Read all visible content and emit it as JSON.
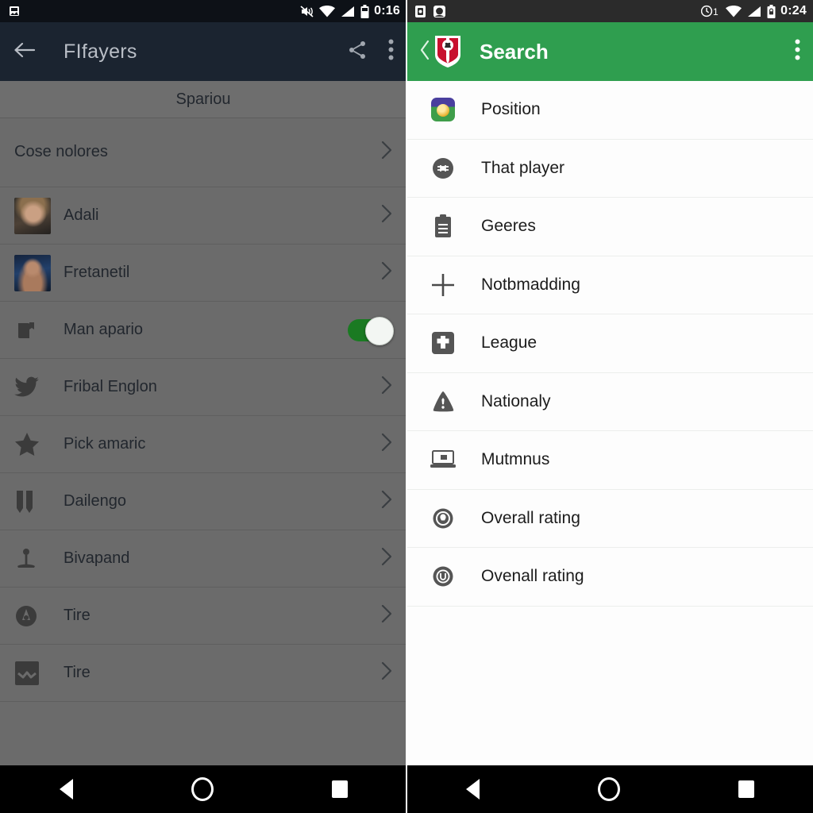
{
  "left": {
    "status_bar": {
      "time": "0:16",
      "icons": [
        "mute-icon",
        "wifi-icon",
        "signal-icon",
        "battery-icon"
      ],
      "left_icons": [
        "app-notification-icon"
      ]
    },
    "appbar": {
      "back_icon": "back-arrow-icon",
      "title": "FIfayers",
      "actions": [
        "share-icon",
        "overflow-menu-icon"
      ]
    },
    "subheader": "Spariou",
    "items": [
      {
        "label": "Cose nolores",
        "icon": "none",
        "trailing": "chevron-right-icon"
      },
      {
        "label": "Adali",
        "icon": "player-photo-1",
        "trailing": "chevron-right-icon"
      },
      {
        "label": "Fretanetil",
        "icon": "player-photo-2",
        "trailing": "chevron-right-icon"
      },
      {
        "label": "Man apario",
        "icon": "book-icon",
        "trailing": "toggle-switch-on"
      },
      {
        "label": "Fribal Englon",
        "icon": "twitter-bird-icon",
        "trailing": "chevron-right-icon"
      },
      {
        "label": "Pick amaric",
        "icon": "star-icon",
        "trailing": "chevron-right-icon"
      },
      {
        "label": "Dailengo",
        "icon": "pause-bars-icon",
        "trailing": "chevron-right-icon"
      },
      {
        "label": "Bivapand",
        "icon": "microphone-stand-icon",
        "trailing": "chevron-right-icon"
      },
      {
        "label": "Tire",
        "icon": "circle-badge-icon",
        "trailing": "chevron-right-icon"
      },
      {
        "label": "Tire",
        "icon": "wave-square-icon",
        "trailing": "chevron-right-icon"
      }
    ],
    "nav": [
      "back-button",
      "home-button",
      "recents-button"
    ]
  },
  "right": {
    "status_bar": {
      "time": "0:24",
      "icons": [
        "alarm-icon",
        "wifi-icon",
        "signal-icon",
        "battery-lock-icon"
      ],
      "left_icons": [
        "sim-icon",
        "app-icon"
      ]
    },
    "appbar": {
      "back_icon": "back-chevron-icon",
      "crest_icon": "club-crest-icon",
      "title": "Search",
      "actions": [
        "overflow-menu-icon"
      ]
    },
    "items": [
      {
        "label": "Position",
        "icon": "position-app-icon"
      },
      {
        "label": "That player",
        "icon": "football-circle-icon"
      },
      {
        "label": "Geeres",
        "icon": "clipboard-icon"
      },
      {
        "label": "Notbmadding",
        "icon": "plus-icon"
      },
      {
        "label": "League",
        "icon": "puzzle-square-icon"
      },
      {
        "label": "Nationaly",
        "icon": "warning-triangle-icon"
      },
      {
        "label": "Mutmnus",
        "icon": "laptop-icon"
      },
      {
        "label": "Overall rating",
        "icon": "speedometer-circle-icon"
      },
      {
        "label": "Ovenall rating",
        "icon": "meter-circle-icon"
      }
    ],
    "nav": [
      "back-button",
      "home-button",
      "recents-button"
    ]
  },
  "colors": {
    "appbar_left_bg": "#1b2430",
    "appbar_right_bg": "#2f9e4f",
    "left_overlay_bg": "#6b6b6b",
    "toggle_on": "#1a7a22",
    "right_list_bg": "#fdfdfd"
  }
}
